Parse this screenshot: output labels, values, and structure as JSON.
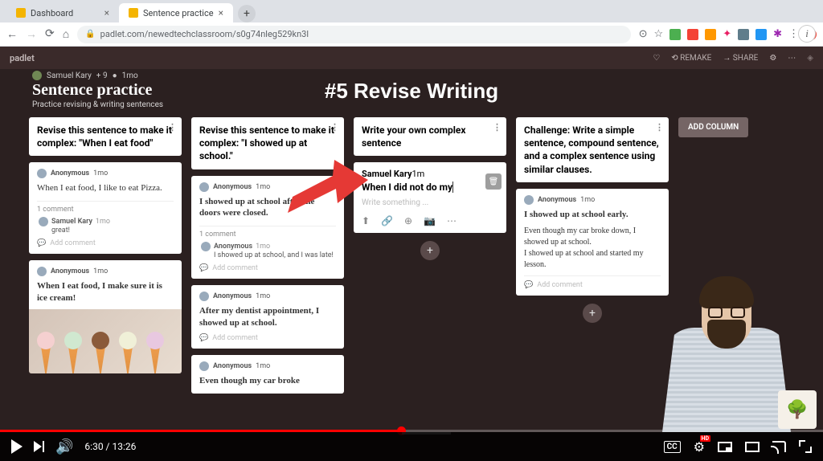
{
  "browser": {
    "tabs": [
      {
        "title": "Dashboard"
      },
      {
        "title": "Sentence practice"
      }
    ],
    "url": "padlet.com/newedtechclassroom/s0g74nleg529kn3l"
  },
  "padlet": {
    "logo": "padlet",
    "actions": {
      "remake": "REMAKE",
      "share": "SHARE"
    },
    "crumbs": {
      "author": "Samuel Kary",
      "collab": "+ 9",
      "time": "1mo"
    },
    "title": "Sentence practice",
    "subtitle": "Practice revising & writing sentences",
    "heading": "#5 Revise Writing",
    "add_column": "ADD COLUMN"
  },
  "columns": [
    {
      "header": "Revise this sentence to make it complex: \"When I eat food\"",
      "cards": [
        {
          "author": "Anonymous",
          "time": "1mo",
          "body": "When I eat food, I like to eat Pizza.",
          "comments_label": "1 comment",
          "reply": {
            "author": "Samuel Kary",
            "time": "1mo",
            "text": "great!"
          },
          "add_comment": "Add comment"
        },
        {
          "author": "Anonymous",
          "time": "1mo",
          "body": "When I eat food, I make sure it is ice cream!",
          "has_image": true
        }
      ]
    },
    {
      "header": "Revise this sentence to make it complex: \"I showed up at school.\"",
      "cards": [
        {
          "author": "Anonymous",
          "time": "1mo",
          "body": "I showed up at school after the doors were closed.",
          "comments_label": "1 comment",
          "reply": {
            "author": "Anonymous",
            "time": "1mo",
            "text": "I showed up at school, and I was late!"
          },
          "add_comment": "Add comment"
        },
        {
          "author": "Anonymous",
          "time": "1mo",
          "body": "After my dentist appointment, I showed up at school.",
          "add_comment": "Add comment"
        },
        {
          "author": "Anonymous",
          "time": "1mo",
          "body": "Even though my car broke"
        }
      ]
    },
    {
      "header": "Write your own complex sentence",
      "composer": {
        "author": "Samuel Kary",
        "time": "1m",
        "title_text": "When I did not do my ",
        "placeholder": "Write something ..."
      }
    },
    {
      "header": "Challenge: Write a simple sentence, compound sentence, and a complex sentence using similar clauses.",
      "cards": [
        {
          "author": "Anonymous",
          "time": "1mo",
          "body": "I showed up at school early.",
          "body_extra": "Even though my car broke down, I showed up at school.\nI showed up at school and started my lesson.",
          "add_comment": "Add comment"
        }
      ]
    }
  ],
  "video": {
    "current": "6:30",
    "duration": "13:26",
    "hd": "HD",
    "cc": "CC"
  }
}
